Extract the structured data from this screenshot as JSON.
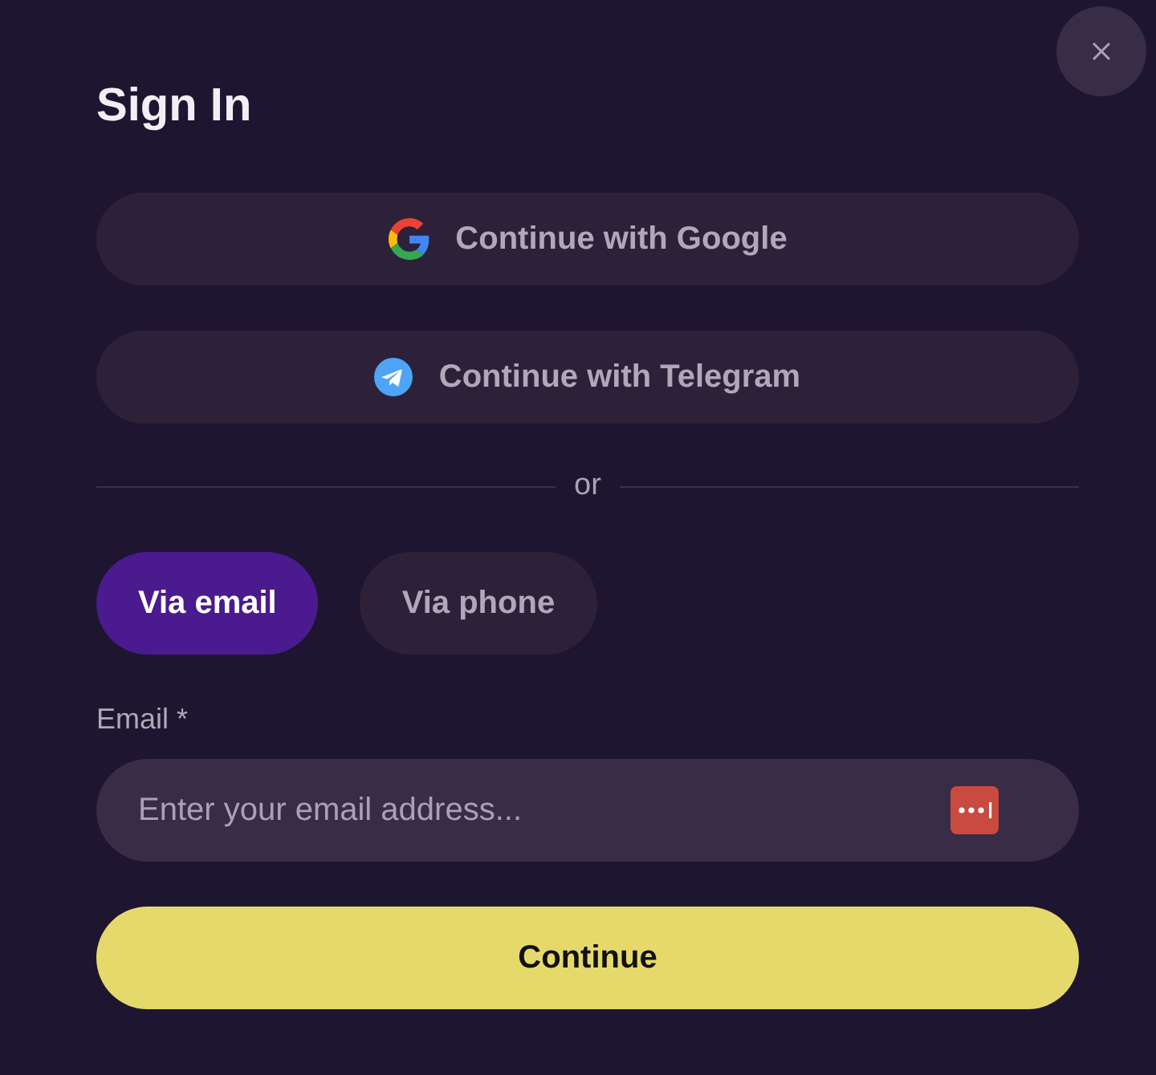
{
  "title": "Sign In",
  "providers": [
    {
      "kind": "google",
      "label": "Continue with Google"
    },
    {
      "kind": "telegram",
      "label": "Continue with Telegram"
    }
  ],
  "divider": "or",
  "tabs": [
    {
      "label": "Via email",
      "selected": true
    },
    {
      "label": "Via phone",
      "selected": false
    }
  ],
  "field": {
    "label": "Email *",
    "placeholder": "Enter your email address..."
  },
  "submit": "Continue"
}
